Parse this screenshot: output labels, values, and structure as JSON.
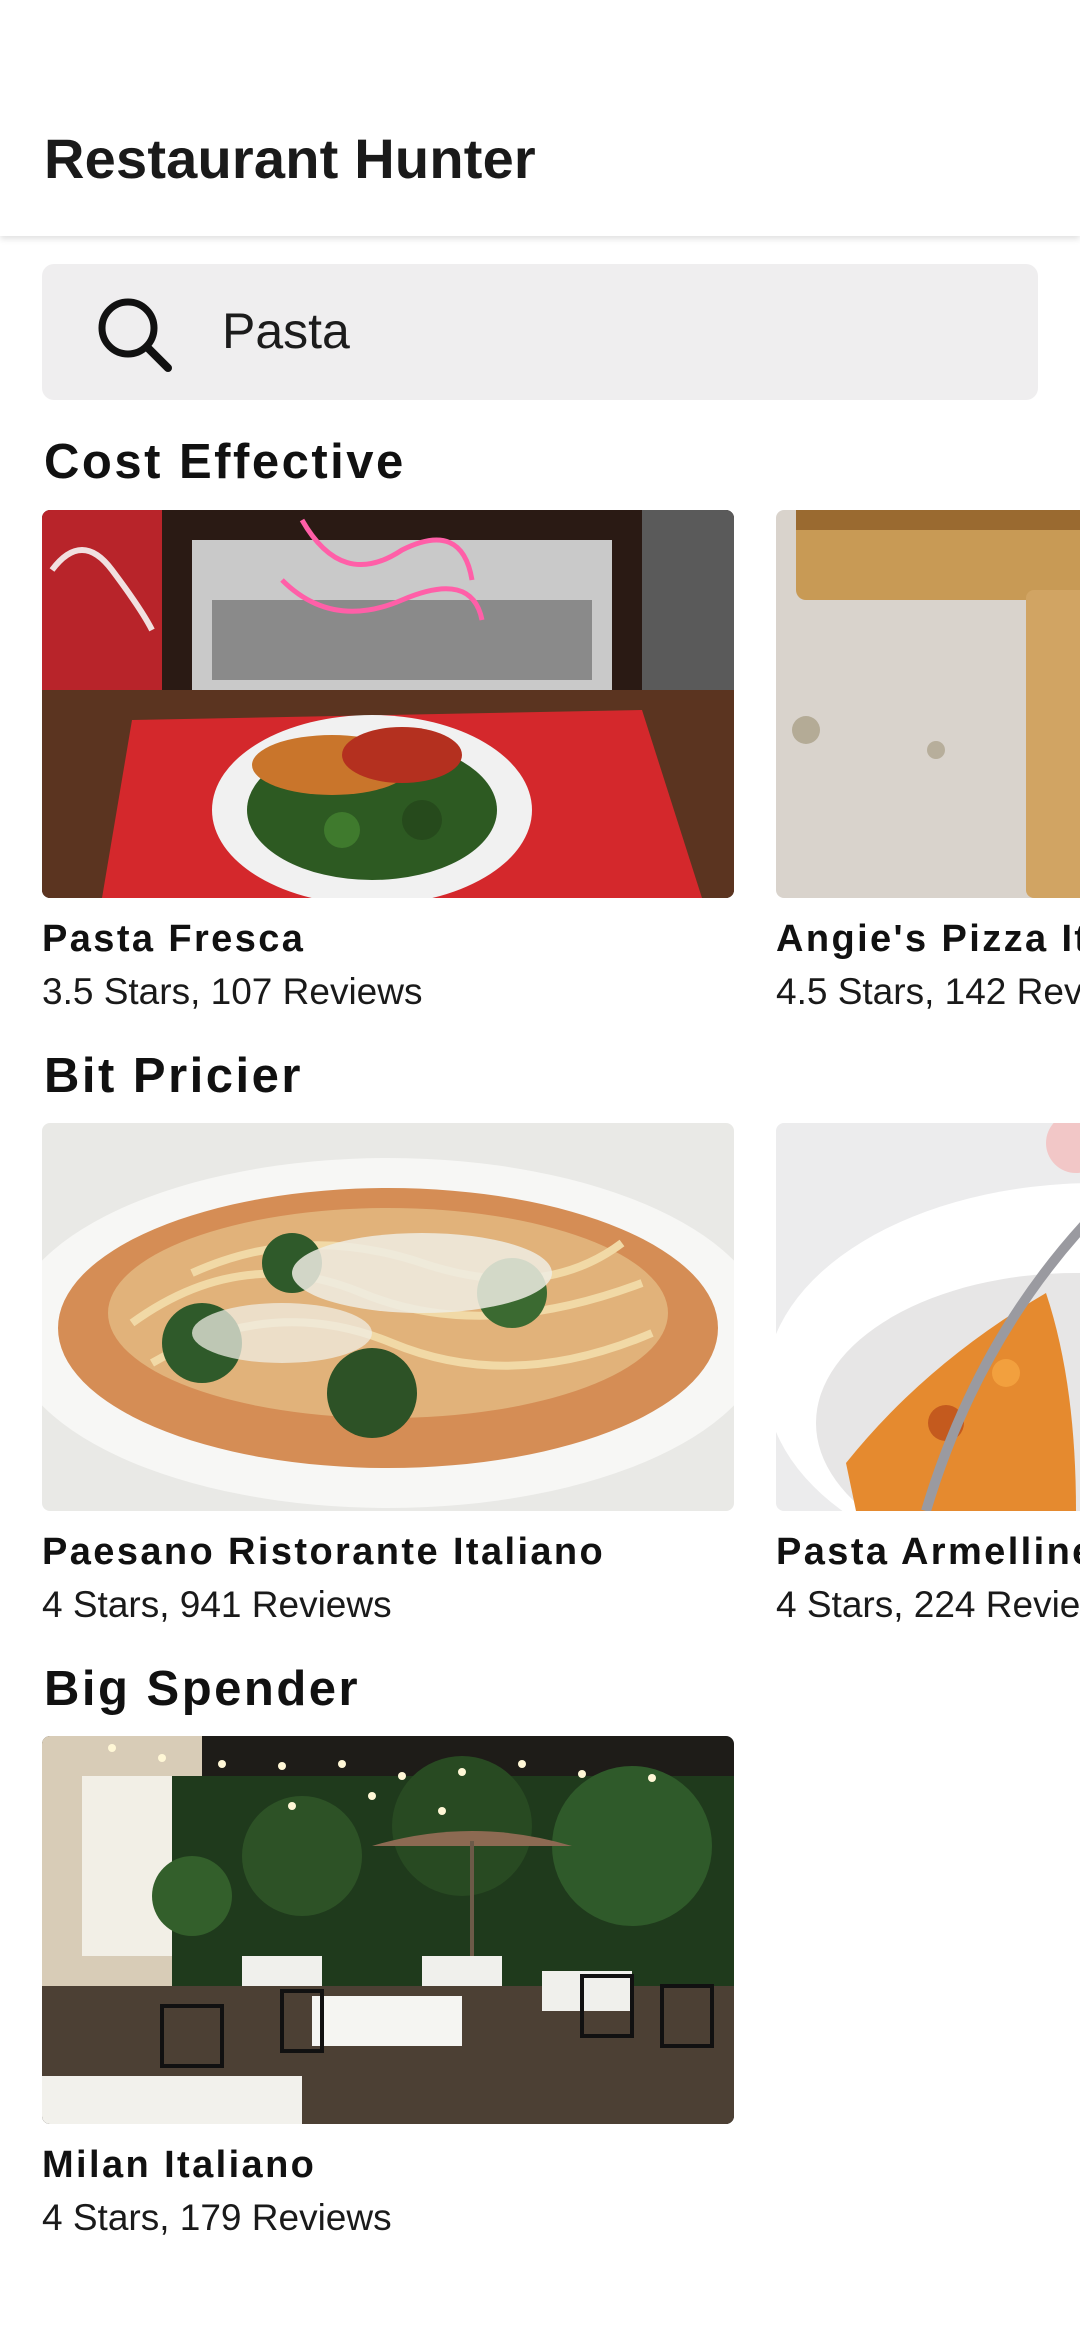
{
  "app": {
    "title": "Restaurant Hunter"
  },
  "search": {
    "value": "Pasta",
    "icon": "search-icon"
  },
  "sections": [
    {
      "title": "Cost Effective",
      "cards": [
        {
          "name": "Pasta Fresca",
          "meta": "3.5 Stars, 107 Reviews",
          "image": "pasta-tray-photo"
        },
        {
          "name": "Angie's Pizza It",
          "meta": "4.5 Stars, 142 Rev",
          "image": "garlic-bread-photo"
        }
      ]
    },
    {
      "title": "Bit Pricier",
      "cards": [
        {
          "name": "Paesano Ristorante Italiano",
          "meta": "4 Stars, 941 Reviews",
          "image": "spaghetti-bowl-photo"
        },
        {
          "name": "Pasta Armelline",
          "meta": "4 Stars, 224 Revie",
          "image": "penne-bowl-photo"
        }
      ]
    },
    {
      "title": "Big Spender",
      "cards": [
        {
          "name": "Milan Italiano",
          "meta": "4 Stars, 179 Reviews",
          "image": "patio-dining-photo"
        }
      ]
    }
  ]
}
